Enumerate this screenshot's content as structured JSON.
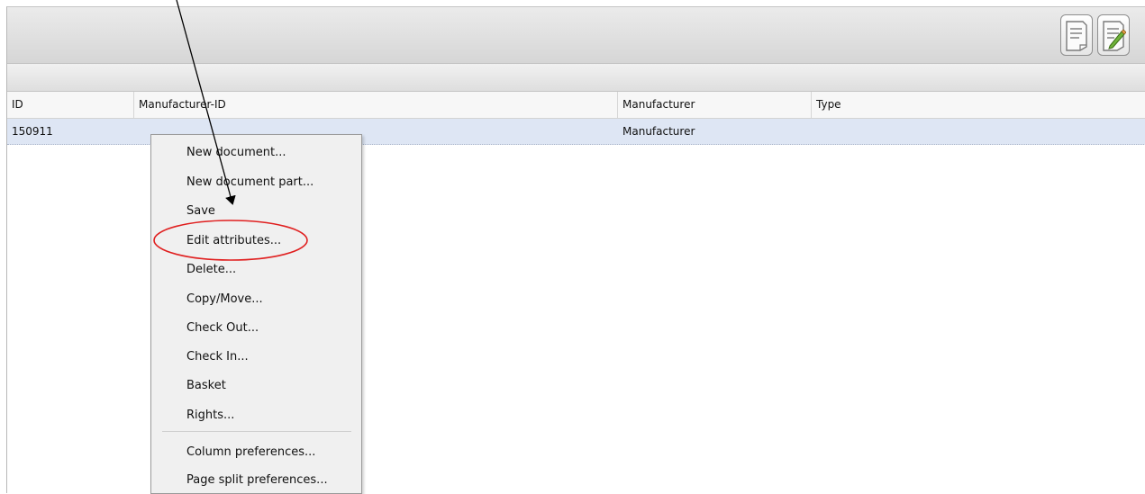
{
  "toolbar": {
    "icons": [
      "document-icon",
      "edit-document-icon"
    ]
  },
  "table": {
    "columns": [
      "ID",
      "Manufacturer-ID",
      "Manufacturer",
      "Type"
    ],
    "rows": [
      {
        "id": "150911",
        "manufacturer_id": "",
        "manufacturer": "Manufacturer",
        "type": ""
      }
    ],
    "selected_row_color": "#dee6f4"
  },
  "context_menu": {
    "items": [
      "New document...",
      "New document part...",
      "Save",
      "Edit attributes...",
      "Delete...",
      "Copy/Move...",
      "Check Out...",
      "Check In...",
      "Basket",
      "Rights...",
      "Column preferences...",
      "Page split preferences..."
    ],
    "highlighted_item": "Edit attributes..."
  },
  "annotations": {
    "ellipse_color": "#e02020",
    "arrow_color": "#000000"
  }
}
